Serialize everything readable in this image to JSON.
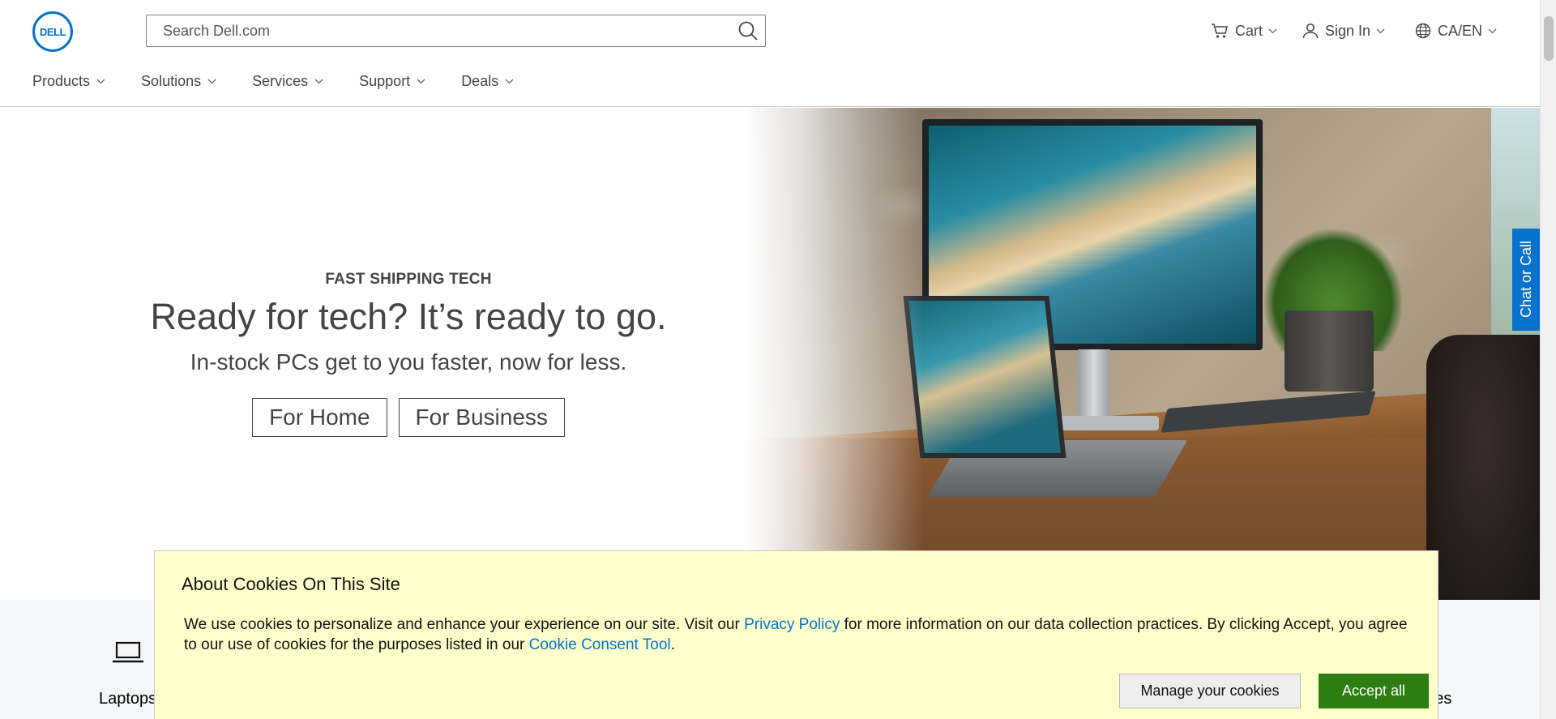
{
  "header": {
    "logo_text": "DELL",
    "search_placeholder": "Search Dell.com",
    "cart_label": "Cart",
    "signin_label": "Sign In",
    "locale_label": "CA/EN"
  },
  "nav": {
    "items": [
      {
        "label": "Products"
      },
      {
        "label": "Solutions"
      },
      {
        "label": "Services"
      },
      {
        "label": "Support"
      },
      {
        "label": "Deals"
      }
    ]
  },
  "hero": {
    "eyebrow": "FAST SHIPPING TECH",
    "headline": "Ready for tech? It’s ready to go.",
    "subhead": "In-stock PCs get to you faster, now for less.",
    "cta_home": "For Home",
    "cta_business": "For Business"
  },
  "chat_tab": {
    "label": "Chat or Call"
  },
  "categories": {
    "laptops_label": "Laptops",
    "accessories_label_visible": "ories"
  },
  "cookie_banner": {
    "title": "About Cookies On This Site",
    "text_1": "We use cookies to personalize and enhance your experience on our site. Visit our ",
    "link_privacy": "Privacy Policy",
    "text_2": " for more information on our data collection practices. By clicking Accept, you agree to our use of cookies for the purposes listed in our ",
    "link_consent": "Cookie Consent Tool",
    "text_3": ".",
    "manage_label": "Manage your cookies",
    "accept_label": "Accept all"
  },
  "colors": {
    "brand_blue": "#0672cb",
    "cookie_bg": "#ffffcc",
    "accept_green": "#2e7d12"
  }
}
